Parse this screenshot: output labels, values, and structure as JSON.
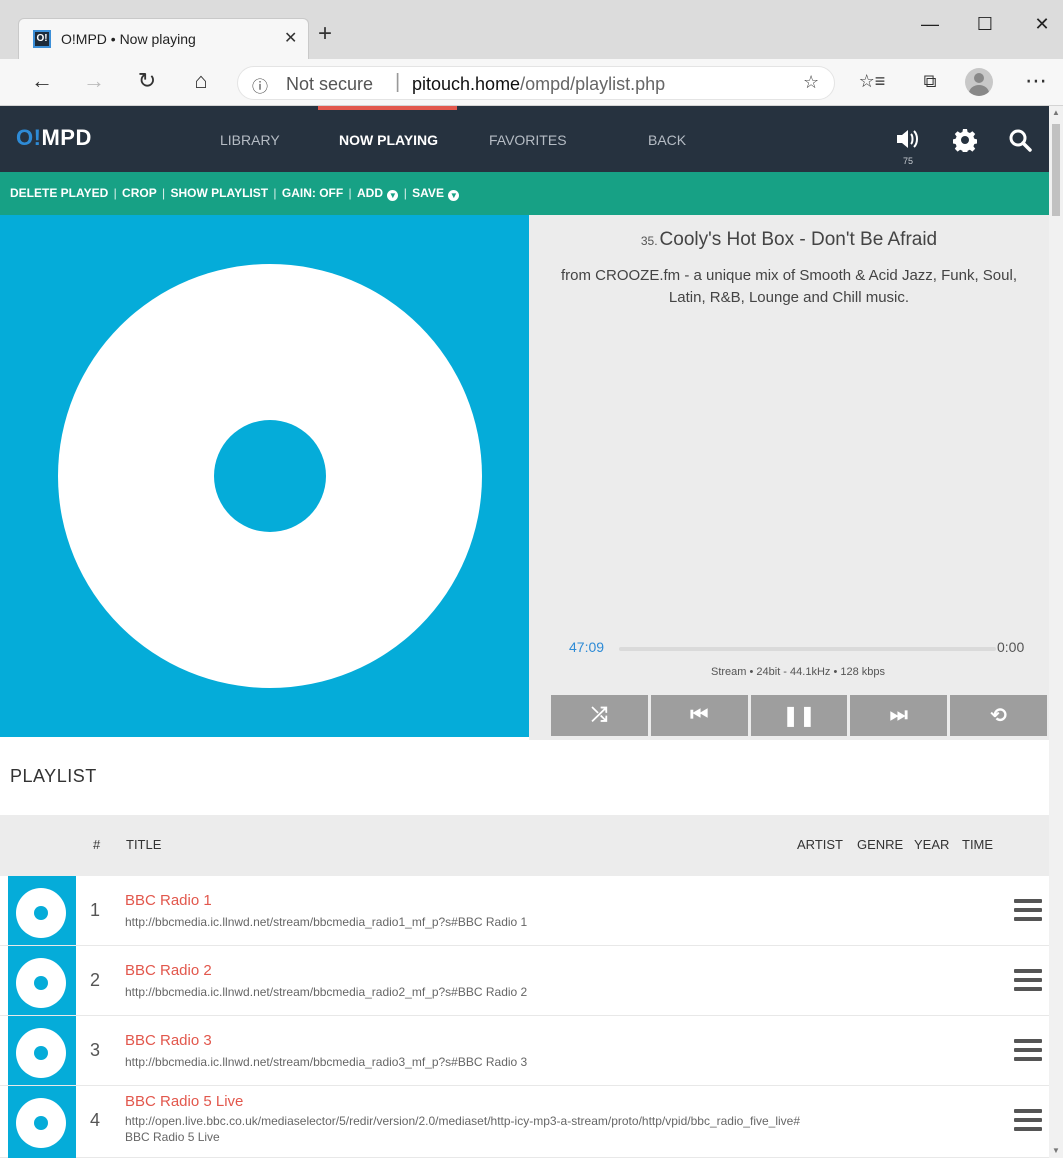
{
  "browser": {
    "tab_title": "O!MPD • Now playing",
    "tab_close": "✕",
    "new_tab": "+",
    "favicon": "O!",
    "window_minimize": "—",
    "window_maximize": "☐",
    "window_close": "✕",
    "security_label": "Not secure",
    "url_host": "pitouch.home",
    "url_path": "/ompd/playlist.php",
    "info_icon": "ⓘ",
    "more_icon": "⋯"
  },
  "app": {
    "logo_accent": "O!",
    "logo_rest": "MPD",
    "nav": [
      "LIBRARY",
      "NOW PLAYING",
      "FAVORITES",
      "BACK"
    ],
    "active_nav": "NOW PLAYING",
    "volume": "75",
    "colors": {
      "header": "#26323f",
      "accent": "#17a185",
      "cover": "#05acd9",
      "highlight": "#e2574c",
      "link": "#2e8bd6"
    }
  },
  "actions": {
    "delete_played": "DELETE PLAYED",
    "crop": "CROP",
    "show_playlist": "SHOW PLAYLIST",
    "gain": "GAIN: OFF",
    "add": "ADD",
    "save": "SAVE"
  },
  "now_playing": {
    "track_number": "35.",
    "title": "Cooly's Hot Box - Don't Be Afraid",
    "description": "from CROOZE.fm - a unique mix of Smooth & Acid Jazz, Funk, Soul, Latin, R&B, Lounge and Chill music.",
    "elapsed": "47:09",
    "remaining": "0:00",
    "progress": 0,
    "stream_info": "Stream • 24bit - 44.1kHz • 128 kbps",
    "controls": [
      {
        "name": "shuffle-button",
        "glyph": "⤮"
      },
      {
        "name": "previous-button",
        "glyph": "⏮"
      },
      {
        "name": "pause-button",
        "glyph": "❚❚"
      },
      {
        "name": "next-button",
        "glyph": "⏭"
      },
      {
        "name": "repeat-button",
        "glyph": "⟲"
      }
    ]
  },
  "playlist": {
    "heading": "PLAYLIST",
    "columns": {
      "num": "#",
      "title": "TITLE",
      "artist": "ARTIST",
      "genre": "GENRE",
      "year": "YEAR",
      "time": "TIME"
    },
    "rows": [
      {
        "num": "1",
        "title": "BBC Radio 1",
        "url": "http://bbcmedia.ic.llnwd.net/stream/bbcmedia_radio1_mf_p?s#BBC Radio 1"
      },
      {
        "num": "2",
        "title": "BBC Radio 2",
        "url": "http://bbcmedia.ic.llnwd.net/stream/bbcmedia_radio2_mf_p?s#BBC Radio 2"
      },
      {
        "num": "3",
        "title": "BBC Radio 3",
        "url": "http://bbcmedia.ic.llnwd.net/stream/bbcmedia_radio3_mf_p?s#BBC Radio 3"
      },
      {
        "num": "4",
        "title": "BBC Radio 5 Live",
        "url": "http://open.live.bbc.co.uk/mediaselector/5/redir/version/2.0/mediaset/http-icy-mp3-a-stream/proto/http/vpid/bbc_radio_five_live#BBC Radio 5 Live"
      }
    ]
  }
}
